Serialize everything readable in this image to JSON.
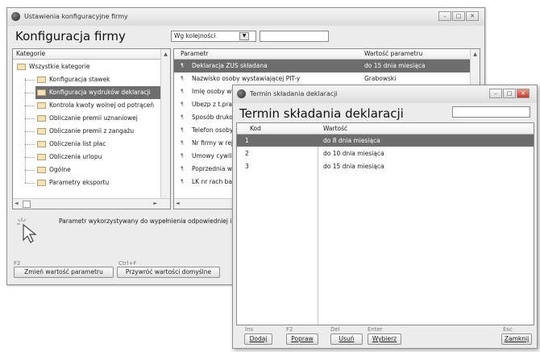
{
  "main": {
    "title": "Ustawienia konfiguracyjne firmy",
    "header": "Konfiguracja firmy",
    "filter_select": "Wg kolejności",
    "categories": {
      "column": "Kategorie",
      "root": "Wszystkie kategorie",
      "items": [
        {
          "label": "Konfiguracja stawek",
          "selected": false
        },
        {
          "label": "Konfiguracja wydruków deklaracji",
          "selected": true
        },
        {
          "label": "Kontrola kwoty wolnej od potrąceń",
          "selected": false
        },
        {
          "label": "Obliczanie premii uznaniowej",
          "selected": false
        },
        {
          "label": "Obliczanie premii z zangażu",
          "selected": false
        },
        {
          "label": "Obliczenia list płac",
          "selected": false
        },
        {
          "label": "Obliczenia urlopu",
          "selected": false
        },
        {
          "label": "Ogólne",
          "selected": false
        },
        {
          "label": "Parametry eksportu",
          "selected": false
        }
      ]
    },
    "parameters": {
      "col_param": "Parametr",
      "col_value": "Wartość parametru",
      "rows": [
        {
          "name": "Deklaracja ZUS składana",
          "value": "do 15 dnia miesiąca",
          "selected": true
        },
        {
          "name": "Nazwisko osoby wystawiającej PIT-y",
          "value": "Grabowski",
          "selected": false
        },
        {
          "name": "Imię osoby wystawiającej PIT-y",
          "value": "",
          "selected": false
        },
        {
          "name": "Ubezp z t.prac.",
          "value": "",
          "selected": false
        },
        {
          "name": "Sposób drukowania",
          "value": "",
          "selected": false
        },
        {
          "name": "Telefon osoby wystawiającej",
          "value": "",
          "selected": false
        },
        {
          "name": "Nr firmy w rejestrze",
          "value": "",
          "selected": false
        },
        {
          "name": "Umowy cywilnoprawne",
          "value": "",
          "selected": false
        },
        {
          "name": "Poprzednia wersja",
          "value": "",
          "selected": false
        },
        {
          "name": "LK nr rach bankowego",
          "value": "",
          "selected": false
        }
      ]
    },
    "description": "Parametr wykorzystywany do wypełnienia odpowiedniej informacji na deklaracji.",
    "hint_f2": "F2",
    "hint_ctrl": "Ctrl+F",
    "btn_change": "Zmień wartość parametru",
    "btn_default": "Przywróć wartości domyślne"
  },
  "dialog": {
    "title": "Termin składania deklaracji",
    "header": "Termin składania deklaracji",
    "col_code": "Kod",
    "col_value": "Wartość",
    "rows": [
      {
        "code": "1",
        "value": "do 8 dnia miesiąca",
        "selected": true
      },
      {
        "code": "2",
        "value": "do 10 dnia miesiąca",
        "selected": false
      },
      {
        "code": "3",
        "value": "do 15 dnia miesiąca",
        "selected": false
      }
    ],
    "hints": {
      "ins": "Ins",
      "f2": "F2",
      "del": "Del",
      "enter": "Enter",
      "esc": "Esc"
    },
    "buttons": {
      "add": "Dodaj",
      "edit": "Popraw",
      "delete": "Usuń",
      "choose": "Wybierz",
      "close": "Zamknij"
    }
  }
}
